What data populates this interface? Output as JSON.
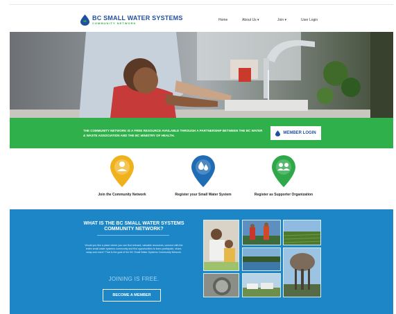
{
  "header": {
    "logo_title": "BC SMALL WATER SYSTEMS",
    "logo_subtitle": "COMMUNITY NETWORK",
    "logo_icon": "water-drop-icon",
    "nav": [
      {
        "label": "Home"
      },
      {
        "label": "About Us ▾"
      },
      {
        "label": "Join ▾"
      },
      {
        "label": "User Login"
      }
    ]
  },
  "banner": {
    "text": "THE COMMUNITY NETWORK IS A FREE RESOURCE AVAILABLE THROUGH A PARTNERSHIP BETWEEN THE BC WATER & WASTE ASSOCIATION AND THE BC MINISTRY OF HEALTH.",
    "button_label": "MEMBER LOGIN",
    "button_icon": "water-drop-icon"
  },
  "features": [
    {
      "label": "Join the Community Network",
      "icon": "user-icon",
      "color": "#f0b21c"
    },
    {
      "label": "Register your Small Water System",
      "icon": "water-drops-icon",
      "color": "#1f6cb5"
    },
    {
      "label": "Register as Supporter Organization",
      "icon": "users-icon",
      "color": "#2fa84a"
    }
  ],
  "about": {
    "title": "WHAT IS THE BC SMALL WATER SYSTEMS COMMUNITY NETWORK?",
    "body": "Would you like a place where you can find relevant, valuable resources, connect with the entire small water systems community and find opportunities to learn,participate, share, swap and more? That is the goal of the BC Small Water Systems Community Network.",
    "joining": "JOINING IS FREE.",
    "button_label": "BECOME A MEMBER"
  },
  "colors": {
    "green": "#2fb04a",
    "blue": "#1c86c7",
    "brand_blue": "#1f4f9e"
  }
}
